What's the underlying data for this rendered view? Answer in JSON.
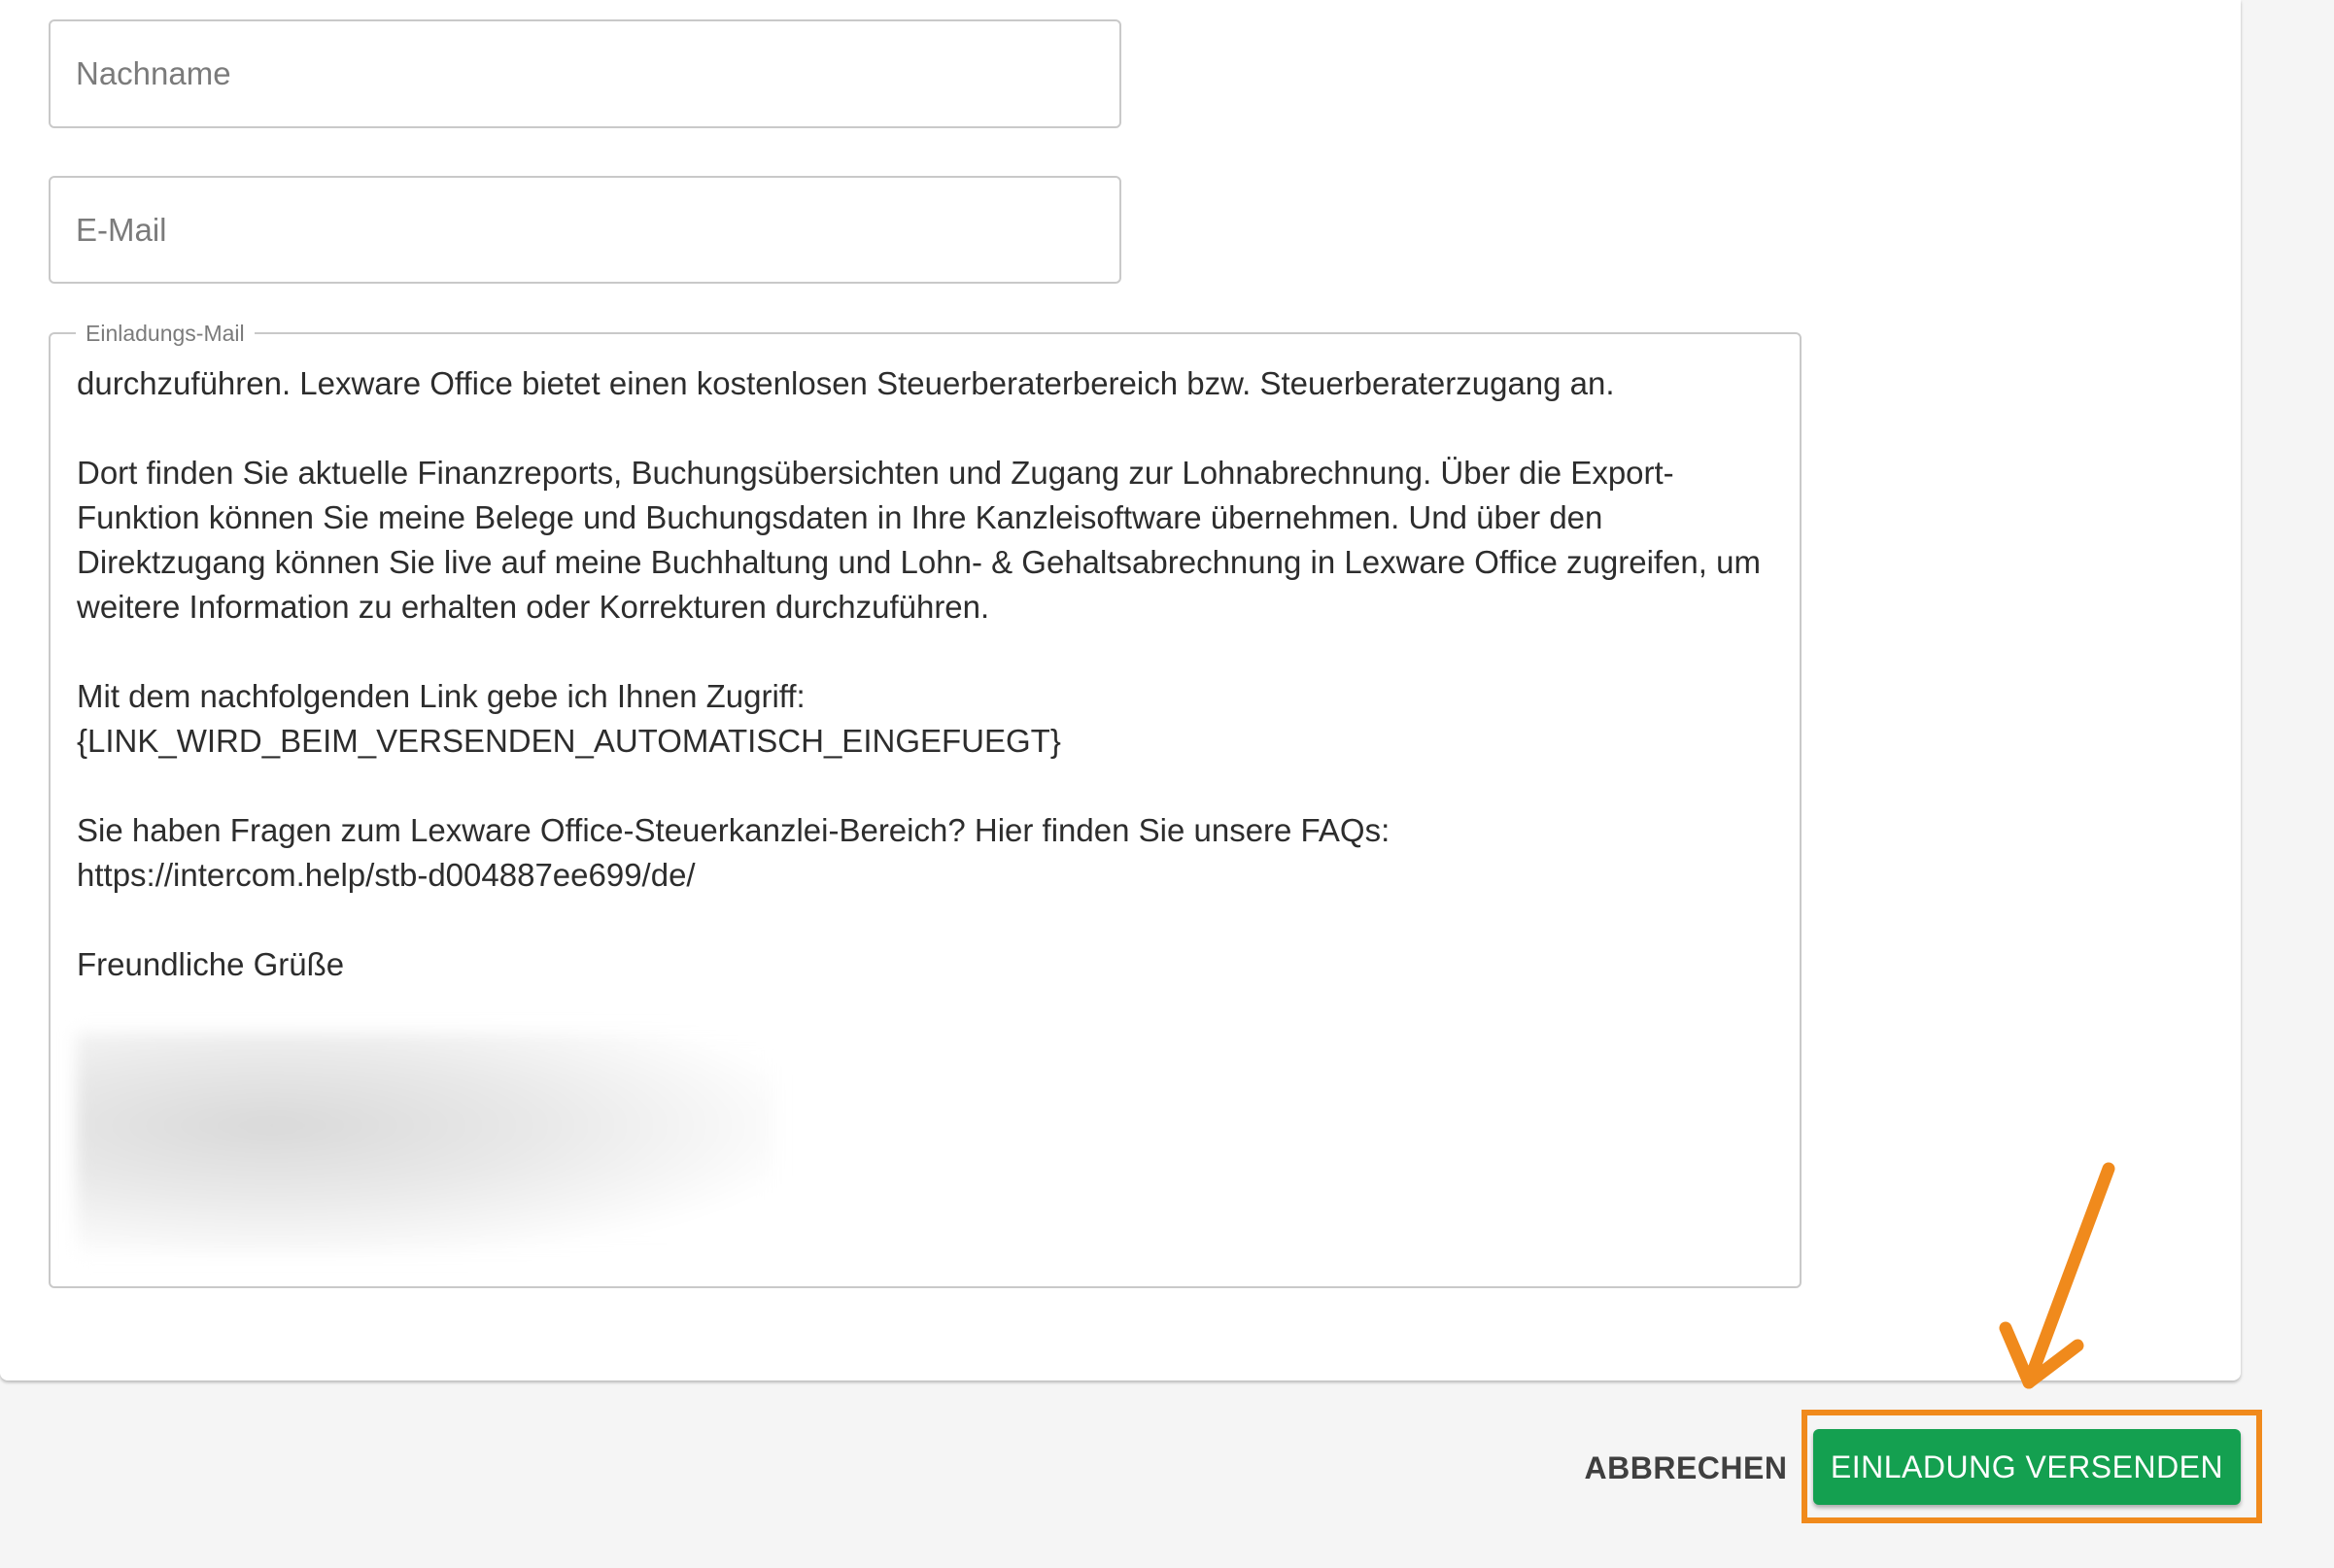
{
  "form": {
    "lastname": {
      "placeholder": "Nachname",
      "value": ""
    },
    "email": {
      "placeholder": "E-Mail",
      "value": ""
    },
    "invitation_mail": {
      "label": "Einladungs-Mail",
      "paragraphs": [
        "durchzuführen. Lexware Office bietet einen kostenlosen Steuerberaterbereich bzw. Steuerberaterzugang an.",
        "Dort finden Sie aktuelle Finanzreports, Buchungsübersichten und Zugang zur Lohnabrechnung. Über die Export-Funktion können Sie meine Belege und Buchungsdaten in Ihre Kanzleisoftware übernehmen. Und über den Direktzugang können Sie live auf meine Buchhaltung und Lohn- & Gehaltsabrechnung in Lexware Office zugreifen, um weitere Information zu erhalten oder Korrekturen durchzuführen.",
        "Mit dem nachfolgenden Link gebe ich Ihnen Zugriff:\n{LINK_WIRD_BEIM_VERSENDEN_AUTOMATISCH_EINGEFUEGT}",
        "Sie haben Fragen zum Lexware Office-Steuerkanzlei-Bereich? Hier finden Sie unsere FAQs:\nhttps://intercom.help/stb-d004887ee699/de/",
        "Freundliche Grüße"
      ]
    }
  },
  "actions": {
    "cancel_label": "ABBRECHEN",
    "send_label": "EINLADUNG VERSENDEN"
  },
  "colors": {
    "primary_button": "#14a050",
    "annotation_orange": "#f08a1c"
  }
}
